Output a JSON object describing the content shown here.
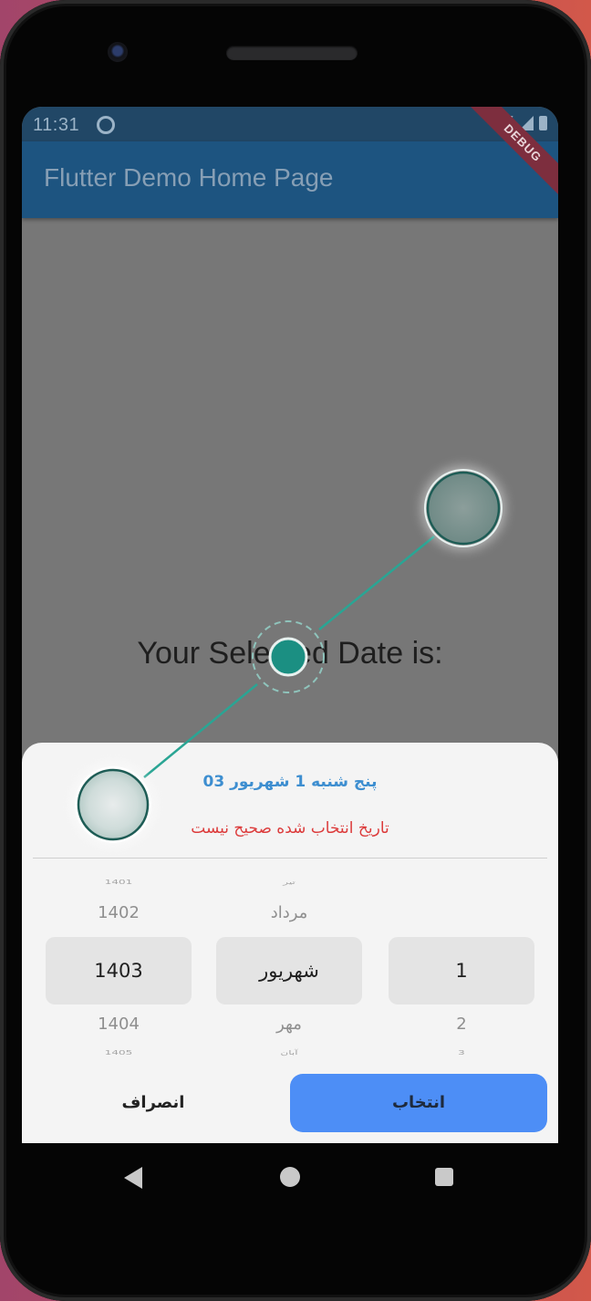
{
  "status_bar": {
    "time": "11:31"
  },
  "app_bar": {
    "title": "Flutter Demo Home Page",
    "debug_label": "DEBUG"
  },
  "main": {
    "selected_label": "Your Selected Date is:"
  },
  "date_sheet": {
    "selected_date": "پنج شنبه 1 شهریور 03",
    "error": "تاریخ انتخاب شده صحیح نیست",
    "year_wheel": {
      "far_above": "1401",
      "above": "1402",
      "selected": "1403",
      "below": "1404",
      "far_below": "1405"
    },
    "month_wheel": {
      "far_above": "تیر",
      "above": "مرداد",
      "selected": "شهریور",
      "below": "مهر",
      "far_below": "آبان"
    },
    "day_wheel": {
      "selected": "1",
      "below": "2",
      "far_below": "3"
    },
    "cancel_label": "انصراف",
    "confirm_label": "انتخاب"
  },
  "colors": {
    "app_bar": "#1d5480",
    "status_bar": "#214766",
    "scrim": "#777777",
    "sheet": "#f4f4f4",
    "date_text": "#3d8ed0",
    "error_text": "#dc3b3b",
    "confirm_button": "#4d8ef6",
    "gesture": "#1b9c8a"
  }
}
